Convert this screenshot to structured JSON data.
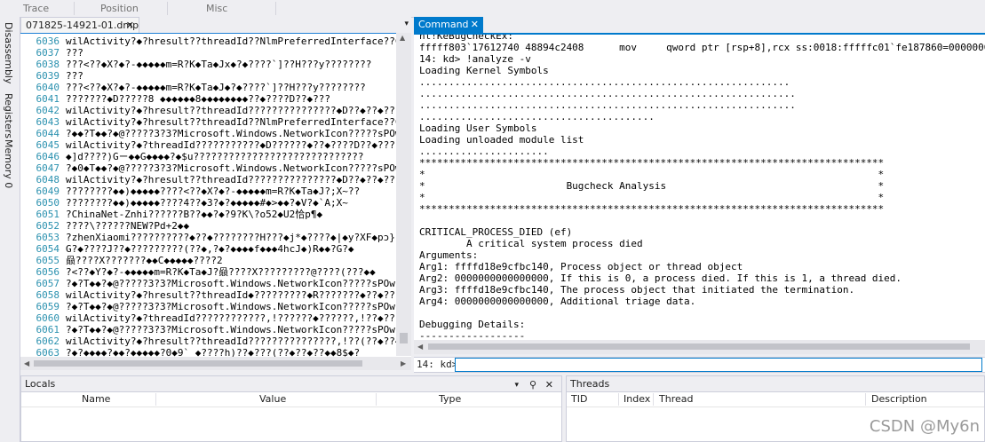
{
  "toolbar": {
    "columns": [
      "Trace",
      "Position",
      "Misc"
    ]
  },
  "side_tabs": [
    "Disassembly",
    "Registers",
    "Memory 0"
  ],
  "left_tab": {
    "title": "071825-14921-01.dmp",
    "close": "✕"
  },
  "left_code": [
    {
      "ln": "6036",
      "text": "wilActivity?◆?hresult??threadId??NlmPreferredInterface??Cach"
    },
    {
      "ln": "6037",
      "text": "???"
    },
    {
      "ln": "6038",
      "text": "???<??◆X?◆?-◆◆◆◆◆m=R?K◆Ta◆Jx◆?◆????`]??H???y????????"
    },
    {
      "ln": "6039",
      "text": "???"
    },
    {
      "ln": "6040",
      "text": "???<??◆X?◆?-◆◆◆◆◆m=R?K◆Ta◆J◆?◆????`]??H???y????????"
    },
    {
      "ln": "6041",
      "text": "???????◆D?????8 ◆◆◆◆◆◆8◆◆◆◆◆◆◆◆??◆????D??◆???"
    },
    {
      "ln": "6042",
      "text": "wilActivity?◆?hresult??threadId???????????????◆D??◆??◆???"
    },
    {
      "ln": "6043",
      "text": "wilActivity?◆?hresult??threadId??NlmPreferredInterface??Cach"
    },
    {
      "ln": "6044",
      "text": "?◆◆?T◆◆?◆@?????3?3?Microsoft.Windows.NetworkIcon?????sPOw"
    },
    {
      "ln": "6045",
      "text": "wilActivity?◆?threadId???????????◆D??????◆??◆????D??◆???"
    },
    {
      "ln": "6046",
      "text": "◆]d????)Gㄧ◆◆G◆◆◆◆?◆$u?????????????????????????????"
    },
    {
      "ln": "6047",
      "text": "?◆0◆T◆◆?◆@?????3?3?Microsoft.Windows.NetworkIcon?????sPOw"
    },
    {
      "ln": "6048",
      "text": "wilActivity?◆?hresult??threadId???????????????◆D??◆??◆???"
    },
    {
      "ln": "6049",
      "text": "????????◆◆)◆◆◆◆◆????<??◆X?◆?-◆◆◆◆◆m=R?K◆Ta◆J?;X~??"
    },
    {
      "ln": "6050",
      "text": "????????◆◆)◆◆◆◆◆????4??◆3?◆?◆◆◆◆◆#◆>◆◆?◆V?◆`A;X~"
    },
    {
      "ln": "6051",
      "text": "?ChinaNet-Znhi??????B??◆◆?◆?9?K\\?o52◆U2恰p¶◆"
    },
    {
      "ln": "6052",
      "text": "????\\??????NEW?Pd+2◆◆"
    },
    {
      "ln": "6053",
      "text": "?zhenXiaomi??????????◆??◆????????H???◆j*◆????◆|◆y?XF◆pɔ}F"
    },
    {
      "ln": "6054",
      "text": "G?◆????J??◆?????????(??◆,?◆?◆◆◆◆f◆◆◆4hcJ◆)R◆◆?G?◆"
    },
    {
      "ln": "6055",
      "text": "赑????X???????◆◆C◆◆◆◆◆????2"
    },
    {
      "ln": "6056",
      "text": "?<??◆Y?◆?-◆◆◆◆◆m=R?K◆Ta◆J?赑????X?????????@????(???◆◆"
    },
    {
      "ln": "6057",
      "text": "?◆?T◆◆?◆@?????3?3?Microsoft.Windows.NetworkIcon?????sPOw"
    },
    {
      "ln": "6058",
      "text": "wilActivity?◆?hresult??threadId◆?????????◆R???????◆??◆????,!??◆???"
    },
    {
      "ln": "6059",
      "text": "?◆?T◆◆?◆@?????3?3?Microsoft.Windows.NetworkIcon?????sPOw"
    },
    {
      "ln": "6060",
      "text": "wilActivity?◆?threadId????????????,!??????◆??????,!??◆???"
    },
    {
      "ln": "6061",
      "text": "?◆?T◆◆?◆@?????3?3?Microsoft.Windows.NetworkIcon?????sPOw"
    },
    {
      "ln": "6062",
      "text": "wilActivity?◆?hresult??threadId???????????????,!??(??◆??◆◆"
    },
    {
      "ln": "6063",
      "text": "?◆?◆◆◆◆?◆◆?◆◆◆◆◆?0◆9`ˎ◆????h)??◆???(??◆??◆??◆◆8$◆?"
    }
  ],
  "command_tab": {
    "title": "Command",
    "close": "✕"
  },
  "command_output": [
    "nt!KeBugCheckEx:",
    "fffff803`17612740 48894c2408      mov     qword ptr [rsp+8],rcx ss:0018:fffffc01`fe187860=0000000000000",
    "14: kd> !analyze -v",
    "Loading Kernel Symbols",
    "...............................................................",
    "................................................................",
    "................................................................",
    "........................................",
    "Loading User Symbols",
    "Loading unloaded module list",
    "......................",
    "*******************************************************************************",
    "*                                                                             *",
    "*                        Bugcheck Analysis                                    *",
    "*                                                                             *",
    "*******************************************************************************",
    "",
    "CRITICAL_PROCESS_DIED (ef)",
    "        A critical system process died",
    "Arguments:",
    "Arg1: ffffd18e9cfbc140, Process object or thread object",
    "Arg2: 0000000000000000, If this is 0, a process died. If this is 1, a thread died.",
    "Arg3: ffffd18e9cfbc140, The process object that initiated the termination.",
    "Arg4: 0000000000000000, Additional triage data.",
    "",
    "Debugging Details:",
    "------------------"
  ],
  "command_prompt": "14: kd>",
  "command_input_value": "",
  "locals": {
    "title": "Locals",
    "columns": [
      "Name",
      "Value",
      "Type"
    ]
  },
  "threads": {
    "title": "Threads",
    "columns": [
      "TID",
      "Index",
      "Thread",
      "Description"
    ]
  },
  "watermark": "CSDN @My6n",
  "colors": {
    "accent": "#007acc",
    "line_number": "#2b91af",
    "panel_bg": "#eeeef2"
  }
}
